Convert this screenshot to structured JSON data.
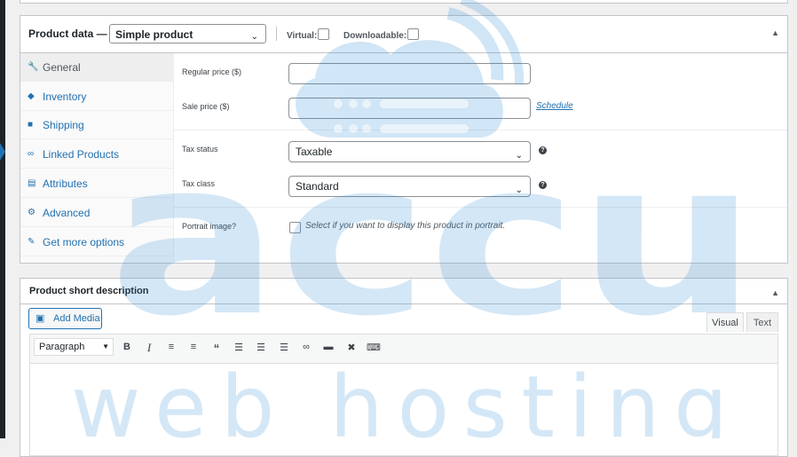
{
  "product_data": {
    "title": "Product data —",
    "product_type": "Simple product",
    "virtual_label": "Virtual:",
    "downloadable_label": "Downloadable:",
    "toggle_icon": "triangle-up-icon",
    "tabs": [
      {
        "label": "General",
        "icon": "wrench-icon",
        "active": true
      },
      {
        "label": "Inventory",
        "icon": "tag-icon",
        "active": false
      },
      {
        "label": "Shipping",
        "icon": "truck-icon",
        "active": false
      },
      {
        "label": "Linked Products",
        "icon": "link-icon",
        "active": false
      },
      {
        "label": "Attributes",
        "icon": "list-icon",
        "active": false
      },
      {
        "label": "Advanced",
        "icon": "gear-icon",
        "active": false
      },
      {
        "label": "Get more options",
        "icon": "plugin-icon",
        "active": false
      }
    ],
    "fields": {
      "regular_price_label": "Regular price ($)",
      "regular_price_value": "",
      "sale_price_label": "Sale price ($)",
      "sale_price_value": "",
      "schedule_link": "Schedule",
      "tax_status_label": "Tax status",
      "tax_status_value": "Taxable",
      "tax_class_label": "Tax class",
      "tax_class_value": "Standard",
      "portrait_label": "Portrait image?",
      "portrait_description": "Select if you want to display this product in portrait."
    }
  },
  "short_description": {
    "title": "Product short description",
    "add_media_label": "Add Media",
    "visual_tab": "Visual",
    "text_tab": "Text",
    "format_select": "Paragraph",
    "toolbar_icons": [
      "bold-icon",
      "italic-icon",
      "bullet-list-icon",
      "numbered-list-icon",
      "blockquote-icon",
      "align-left-icon",
      "align-center-icon",
      "align-right-icon",
      "link-icon",
      "read-more-icon",
      "fullscreen-icon",
      "toolbar-toggle-icon"
    ]
  },
  "watermark": {
    "logo_text": "accu",
    "tagline": "web hosting",
    "color": "#2e8bd4"
  },
  "colors": {
    "accent": "#2271b1",
    "admin_bar": "#1d2327"
  }
}
